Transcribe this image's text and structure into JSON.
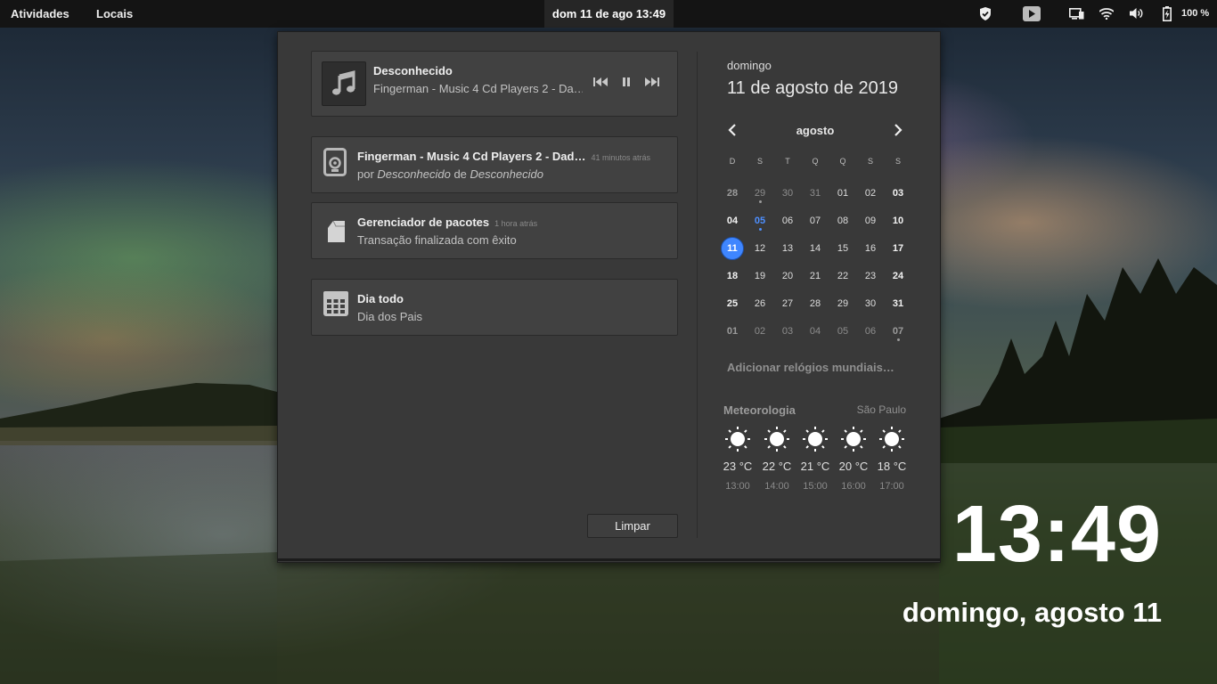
{
  "topbar": {
    "activities": "Atividades",
    "places": "Locais",
    "clock": "dom 11 de ago  13:49",
    "battery": "100 %"
  },
  "media": {
    "title": "Desconhecido",
    "subtitle": "Fingerman - Music 4 Cd Players 2 - Da…"
  },
  "notifications": [
    {
      "title": "Fingerman - Music 4 Cd Players 2 - Dad…",
      "time": "41 minutos atrás",
      "by": "por",
      "artist": "Desconhecido",
      "of": "de",
      "album": "Desconhecido"
    },
    {
      "title": "Gerenciador de pacotes",
      "time": "1 hora atrás",
      "body": "Transação finalizada com êxito"
    }
  ],
  "event": {
    "title": "Dia todo",
    "body": "Dia dos Pais"
  },
  "clear_label": "Limpar",
  "calendar": {
    "day_name": "domingo",
    "date_full": "11 de agosto de 2019",
    "month": "agosto",
    "weekdays": [
      "D",
      "S",
      "T",
      "Q",
      "Q",
      "S",
      "S"
    ],
    "weeks": [
      [
        "28",
        "29",
        "30",
        "31",
        "01",
        "02",
        "03"
      ],
      [
        "04",
        "05",
        "06",
        "07",
        "08",
        "09",
        "10"
      ],
      [
        "11",
        "12",
        "13",
        "14",
        "15",
        "16",
        "17"
      ],
      [
        "18",
        "19",
        "20",
        "21",
        "22",
        "23",
        "24"
      ],
      [
        "25",
        "26",
        "27",
        "28",
        "29",
        "30",
        "31"
      ],
      [
        "01",
        "02",
        "03",
        "04",
        "05",
        "06",
        "07"
      ]
    ],
    "today": "11",
    "accent_color": "#3f86ff"
  },
  "world_clocks": "Adicionar relógios mundiais…",
  "weather": {
    "title": "Meteorologia",
    "location": "São Paulo",
    "forecast": [
      {
        "icon": "sun-icon",
        "temp": "23 °C",
        "hour": "13:00"
      },
      {
        "icon": "sun-icon",
        "temp": "22 °C",
        "hour": "14:00"
      },
      {
        "icon": "sun-icon",
        "temp": "21 °C",
        "hour": "15:00"
      },
      {
        "icon": "sun-icon",
        "temp": "20 °C",
        "hour": "16:00"
      },
      {
        "icon": "sun-icon",
        "temp": "18 °C",
        "hour": "17:00"
      }
    ]
  },
  "desktop_clock": {
    "time": "13:49",
    "date": "domingo, agosto 11"
  }
}
